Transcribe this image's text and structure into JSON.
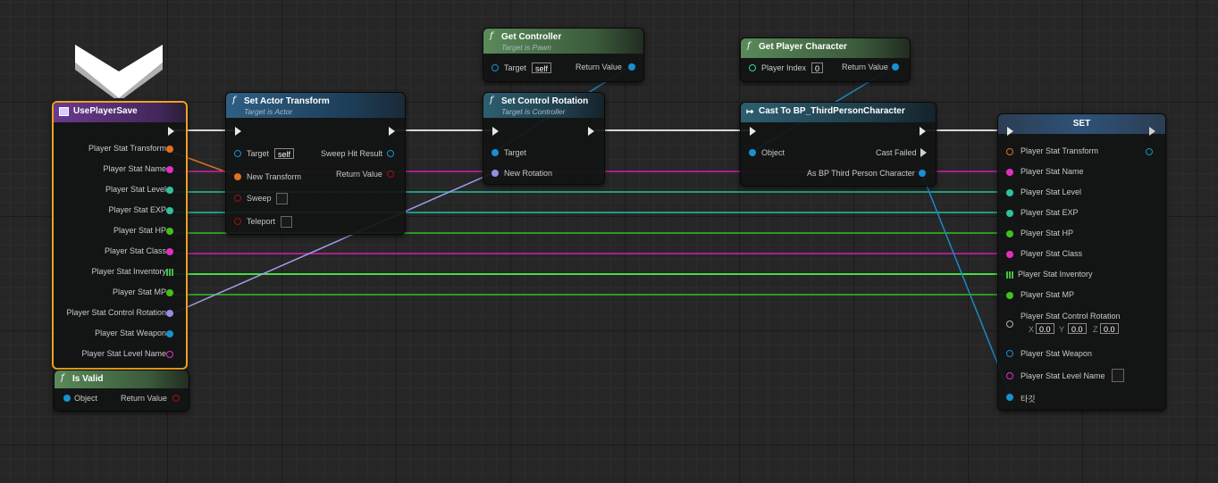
{
  "nodes": {
    "use_player_save": {
      "title": "UsePlayerSave",
      "pins": [
        "Player Stat Transform",
        "Player Stat Name",
        "Player Stat Level",
        "Player Stat EXP",
        "Player Stat HP",
        "Player Stat Class",
        "Player Stat Inventory",
        "Player Stat MP",
        "Player Stat Control Rotation",
        "Player Stat Weapon",
        "Player Stat Level Name"
      ]
    },
    "is_valid": {
      "title": "Is Valid",
      "in": "Object",
      "out": "Return Value"
    },
    "set_actor_transform": {
      "title": "Set Actor Transform",
      "subtitle": "Target is Actor",
      "target": "Target",
      "target_value": "self",
      "new_transform": "New Transform",
      "sweep": "Sweep",
      "teleport": "Teleport",
      "sweep_hit_result": "Sweep Hit Result",
      "return_value": "Return Value"
    },
    "get_controller": {
      "title": "Get Controller",
      "subtitle": "Target is Pawn",
      "target": "Target",
      "target_value": "self",
      "return_value": "Return Value"
    },
    "set_control_rotation": {
      "title": "Set Control Rotation",
      "subtitle": "Target is Controller",
      "target": "Target",
      "new_rotation": "New Rotation"
    },
    "get_player_character": {
      "title": "Get Player Character",
      "player_index": "Player Index",
      "index_value": "0",
      "return_value": "Return Value"
    },
    "cast_to": {
      "title": "Cast To BP_ThirdPersonCharacter",
      "object": "Object",
      "cast_failed": "Cast Failed",
      "as_char": "As BP Third Person Character"
    },
    "set": {
      "title": "SET",
      "pins": [
        "Player Stat Transform",
        "Player Stat Name",
        "Player Stat Level",
        "Player Stat EXP",
        "Player Stat HP",
        "Player Stat Class",
        "Player Stat Inventory",
        "Player Stat MP"
      ],
      "control_rotation": "Player Stat Control Rotation",
      "rot_x_label": "X",
      "rot_x": "0.0",
      "rot_y_label": "Y",
      "rot_y": "0.0",
      "rot_z_label": "Z",
      "rot_z": "0.0",
      "weapon": "Player Stat Weapon",
      "level_name": "Player Stat Level Name",
      "target": "타깃"
    }
  },
  "colors": {
    "transform": "#e07020",
    "string": "#e030c0",
    "int": "#30d0a0",
    "float": "#40d040",
    "inventory": "#40c040",
    "rotator": "#a0a0f0",
    "object": "#20a0e0",
    "exec": "#e8e8e8",
    "bool": "#a01010"
  }
}
